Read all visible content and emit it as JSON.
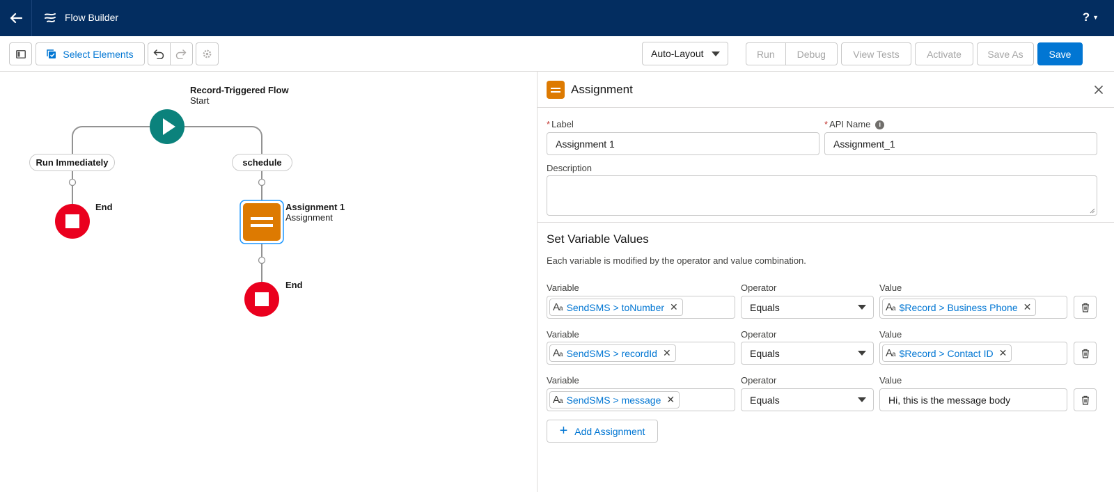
{
  "header": {
    "title": "Flow Builder",
    "help_label": "?"
  },
  "toolbar": {
    "select_elements_label": "Select Elements",
    "layout_mode": "Auto-Layout",
    "run_label": "Run",
    "debug_label": "Debug",
    "view_tests_label": "View Tests",
    "activate_label": "Activate",
    "save_as_label": "Save As",
    "save_label": "Save"
  },
  "canvas": {
    "start": {
      "title": "Record-Triggered Flow",
      "subtitle": "Start"
    },
    "branches": [
      "Run Immediately",
      "schedule"
    ],
    "end_left": "End",
    "assignment": {
      "title": "Assignment 1",
      "subtitle": "Assignment"
    },
    "end_right": "End"
  },
  "panel": {
    "title": "Assignment",
    "label_field": {
      "label": "Label",
      "value": "Assignment 1"
    },
    "api_field": {
      "label": "API Name",
      "value": "Assignment_1"
    },
    "description_label": "Description",
    "section_title": "Set Variable Values",
    "section_help": "Each variable is modified by the operator and value combination.",
    "col_variable": "Variable",
    "col_operator": "Operator",
    "col_value": "Value",
    "rows": [
      {
        "variable": "SendSMS > toNumber",
        "operator": "Equals",
        "value": "$Record > Business Phone"
      },
      {
        "variable": "SendSMS > recordId",
        "operator": "Equals",
        "value": "$Record > Contact ID"
      },
      {
        "variable": "SendSMS > message",
        "operator": "Equals",
        "value": "Hi, this is the message body"
      }
    ],
    "add_assignment_label": "Add Assignment"
  },
  "colors": {
    "header_bg": "#032d60",
    "brand_blue": "#0176d3",
    "start_node": "#0b827c",
    "end_node": "#ea001e",
    "assignment_node": "#dd7a01"
  }
}
